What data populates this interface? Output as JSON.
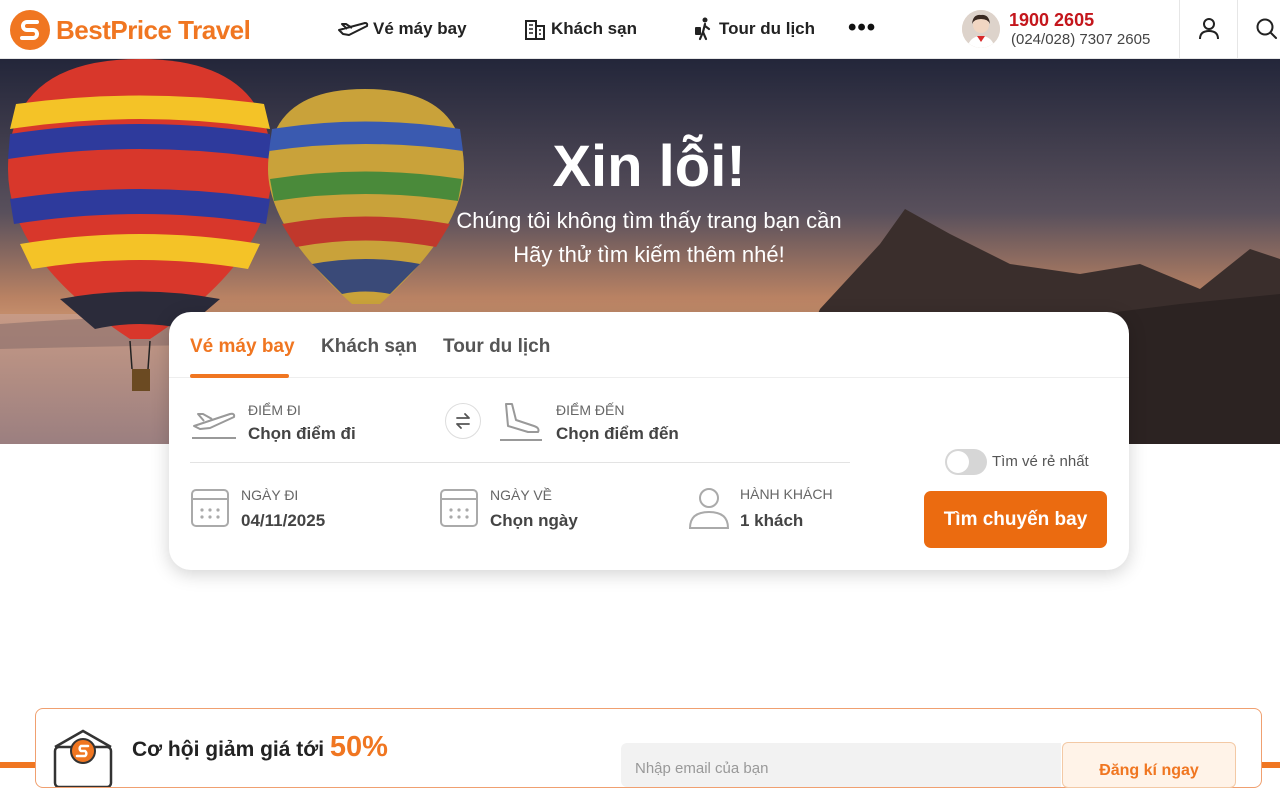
{
  "header": {
    "brand": "BestPrice Travel",
    "nav": [
      {
        "label": "Vé máy bay",
        "icon": "plane-icon"
      },
      {
        "label": "Khách sạn",
        "icon": "hotel-icon"
      },
      {
        "label": "Tour du lịch",
        "icon": "traveler-icon"
      }
    ],
    "more_label": "•••",
    "hotline": "1900 2605",
    "hotline_secondary": "(024/028) 7307 2605"
  },
  "hero": {
    "title": "Xin lỗi!",
    "line1": "Chúng tôi không tìm thấy trang bạn cần",
    "line2": "Hãy thử tìm kiếm thêm nhé!"
  },
  "search": {
    "tabs": [
      "Vé máy bay",
      "Khách sạn",
      "Tour du lịch"
    ],
    "active_tab": "Vé máy bay",
    "origin_label": "ĐIỂM ĐI",
    "origin_value": "Chọn điểm đi",
    "destination_label": "ĐIỂM ĐẾN",
    "destination_value": "Chọn điểm đến",
    "depart_label": "NGÀY ĐI",
    "depart_value": "04/11/2025",
    "return_label": "NGÀY VỀ",
    "return_value": "Chọn ngày",
    "passenger_label": "HÀNH KHÁCH",
    "passenger_value": "1 khách",
    "cheapest_toggle_label": "Tìm vé rẻ nhất",
    "submit_label": "Tìm chuyến bay"
  },
  "promo": {
    "text": "Cơ hội giảm giá tới",
    "percent": "50%",
    "email_placeholder": "Nhập email của bạn",
    "subscribe_label": "Đăng kí ngay"
  },
  "colors": {
    "brand_orange": "#f07621",
    "button_orange": "#eb6b10",
    "hotline_red": "#c4161c"
  }
}
